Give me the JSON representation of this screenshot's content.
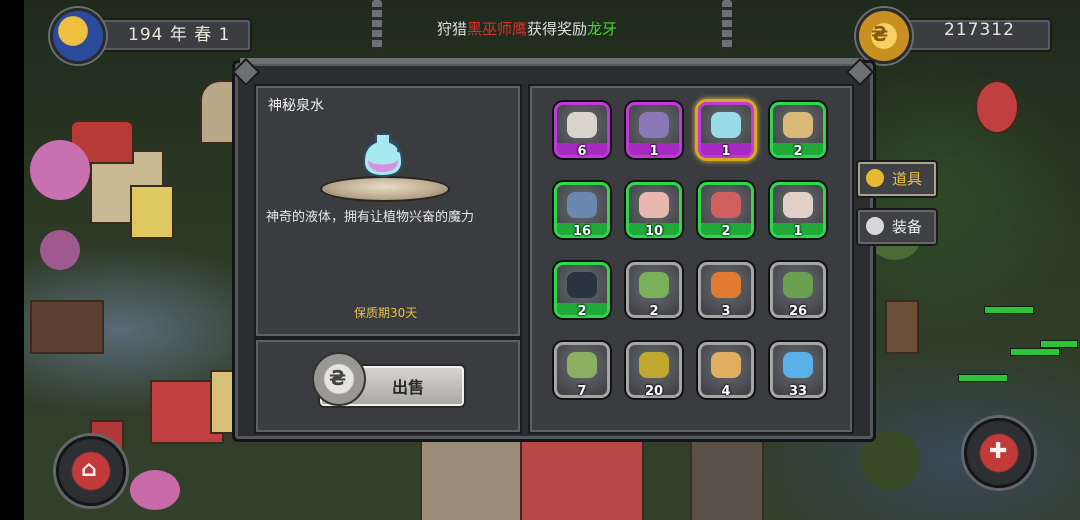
{
  "hud": {
    "date": "194 年 春 1",
    "gold": "217312",
    "ticker": {
      "prefix": "狩猎",
      "hunter": "黑巫师鹰",
      "middle": "获得奖励",
      "reward": "龙牙"
    }
  },
  "detail": {
    "name": "神秘泉水",
    "description": "神奇的液体，拥有让植物兴奋的魔力",
    "shelf_life": "保质期30天",
    "sell_label": "出售"
  },
  "tabs": [
    {
      "label": "道具",
      "active": true,
      "icon": "gourd-icon"
    },
    {
      "label": "装备",
      "active": false,
      "icon": "helmet-icon"
    }
  ],
  "colors": {
    "rarity_green": "#2ed84a",
    "rarity_purple": "#c03ad8",
    "rarity_grey": "#a5a5a5",
    "selected": "#d8a820",
    "shelf_life_text": "#e8c04a"
  },
  "inventory": [
    {
      "icon": "bell-icon",
      "qty": "6",
      "rarity": "purple",
      "color": "#d9d4cc"
    },
    {
      "icon": "book-icon",
      "qty": "1",
      "rarity": "purple",
      "color": "#8a78b8"
    },
    {
      "icon": "potion-jar-icon",
      "qty": "1",
      "rarity": "purple",
      "color": "#9adbe8",
      "selected": true
    },
    {
      "icon": "bread-icon",
      "qty": "2",
      "rarity": "green",
      "color": "#d9b878"
    },
    {
      "icon": "fin-icon",
      "qty": "16",
      "rarity": "green",
      "color": "#6a88b0"
    },
    {
      "icon": "coil-icon",
      "qty": "10",
      "rarity": "green",
      "color": "#e8b8b0"
    },
    {
      "icon": "cloth-icon",
      "qty": "2",
      "rarity": "green",
      "color": "#d06060"
    },
    {
      "icon": "claw-icon",
      "qty": "1",
      "rarity": "green",
      "color": "#e0d0c8"
    },
    {
      "icon": "fang-icon",
      "qty": "2",
      "rarity": "green",
      "color": "#2a3340"
    },
    {
      "icon": "head-icon",
      "qty": "2",
      "rarity": "grey",
      "color": "#7ab05a"
    },
    {
      "icon": "torch-icon",
      "qty": "3",
      "rarity": "grey",
      "color": "#e07a30"
    },
    {
      "icon": "leaf-icon",
      "qty": "26",
      "rarity": "grey",
      "color": "#6aa050"
    },
    {
      "icon": "feather-icon",
      "qty": "7",
      "rarity": "grey",
      "color": "#8ab060"
    },
    {
      "icon": "pineapple-icon",
      "qty": "20",
      "rarity": "grey",
      "color": "#c0a830"
    },
    {
      "icon": "horn-icon",
      "qty": "4",
      "rarity": "grey",
      "color": "#e0b060"
    },
    {
      "icon": "crystal-icon",
      "qty": "33",
      "rarity": "grey",
      "color": "#5ab0e8"
    }
  ]
}
